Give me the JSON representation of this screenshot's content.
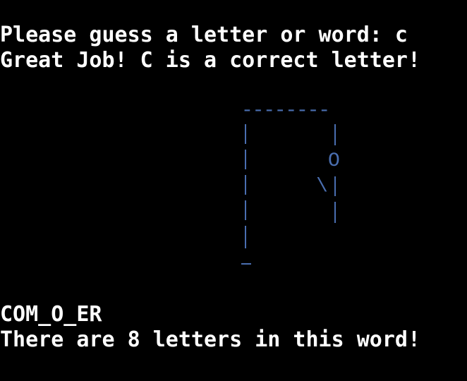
{
  "terminal": {
    "prompt_line": "Please guess a letter or word: c",
    "feedback_line": "Great Job! C is a correct letter!",
    "word_progress": "COM_O_ER",
    "letter_count_line": "There are 8 letters in this word!"
  },
  "gallows": {
    "top_beam": "--------",
    "head": "O",
    "left_arm": "\\",
    "color": "#4a6eb0"
  }
}
